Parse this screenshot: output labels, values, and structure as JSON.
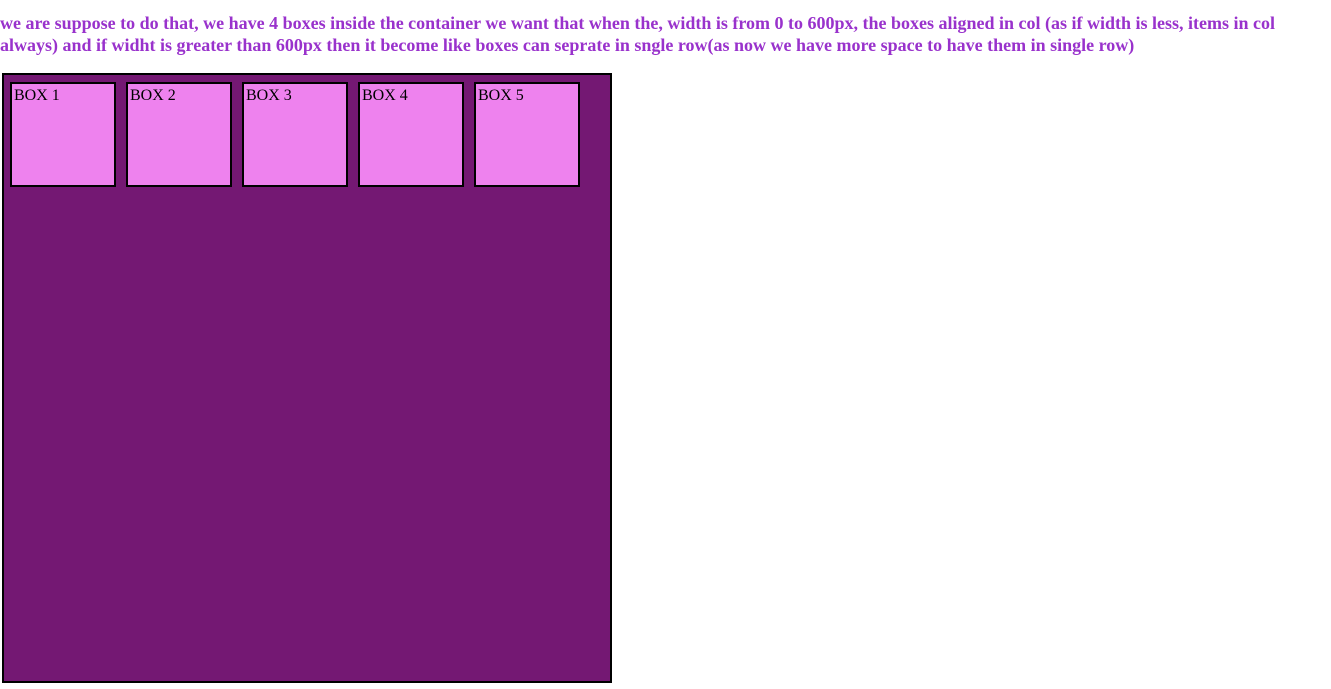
{
  "heading": {
    "line1": "we are suppose to do that, we have 4 boxes inside the container we want that when the, width is from 0 to 600px, the boxes aligned in col (as if width is less, items in col",
    "line2": "always) and if widht is greater than 600px then it become like boxes can seprate in sngle row(as now we have more space to have them in single row)"
  },
  "boxes": [
    {
      "label": "BOX 1"
    },
    {
      "label": "BOX 2"
    },
    {
      "label": "BOX 3"
    },
    {
      "label": "BOX 4"
    },
    {
      "label": "BOX 5"
    }
  ],
  "colors": {
    "heading": "#9932cc",
    "container": "#741873",
    "box": "#ee82ee",
    "border": "#000000"
  }
}
